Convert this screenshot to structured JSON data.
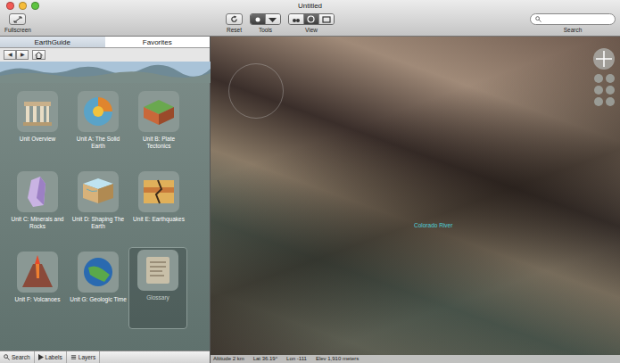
{
  "window": {
    "title": "Untitled"
  },
  "toolbar": {
    "fullscreen": "Fullscreen",
    "reset": "Reset",
    "tools": {
      "label": "Tools",
      "buttons": [
        {
          "selected": true
        },
        {
          "selected": false
        }
      ]
    },
    "view": {
      "label": "View",
      "buttons": [
        {
          "selected": false
        },
        {
          "selected": true
        },
        {
          "selected": false
        }
      ]
    },
    "search": {
      "label": "Search",
      "placeholder": ""
    }
  },
  "tabs": [
    {
      "label": "EarthGuide",
      "selected": true
    },
    {
      "label": "Favorites",
      "selected": false
    }
  ],
  "nav": {
    "back": "◀",
    "forward": "▶"
  },
  "units": [
    {
      "label": "Unit Overview",
      "kind": "overview",
      "selected": false
    },
    {
      "label": "Unit A: The Solid Earth",
      "kind": "earth",
      "selected": false
    },
    {
      "label": "Unit B: Plate Tectonics",
      "kind": "plates",
      "selected": false
    },
    {
      "label": "Unit C: Minerals and Rocks",
      "kind": "minerals",
      "selected": false
    },
    {
      "label": "Unit D: Shaping The Earth",
      "kind": "shaping",
      "selected": false
    },
    {
      "label": "Unit E: Earthquakes",
      "kind": "quakes",
      "selected": false
    },
    {
      "label": "Unit F: Volcanoes",
      "kind": "volcano",
      "selected": false
    },
    {
      "label": "Unit G: Geologic Time",
      "kind": "time",
      "selected": false
    },
    {
      "label": "Glossary",
      "kind": "glossary",
      "selected": true
    }
  ],
  "bottom_tabs": [
    "Search",
    "Labels",
    "Layers"
  ],
  "map_labels": [
    {
      "text": "Colorado River"
    }
  ],
  "status_bar": {
    "altitude": "Altitude 2 km",
    "lat": "Lat 36.19°",
    "lon": "Lon -111",
    "elev": "Elev 1,910 meters"
  }
}
